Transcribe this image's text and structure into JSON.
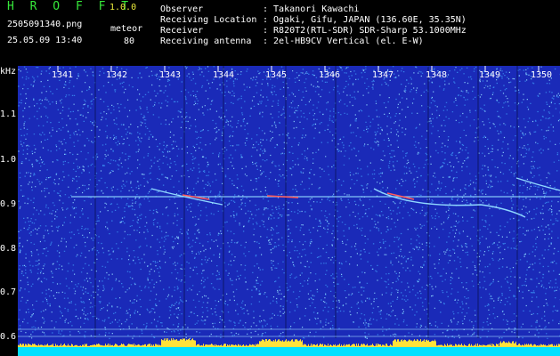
{
  "header": {
    "app_title": "H R O F F T",
    "version": "1.0.0",
    "filename": "2505091340.png",
    "datetime": "25.05.09 13:40",
    "count_label": "meteor",
    "count_value": "80",
    "fields": [
      {
        "label": "Observer",
        "value": ": Takanori Kawachi"
      },
      {
        "label": "Receiving Location",
        "value": ": Ogaki, Gifu, JAPAN (136.60E, 35.35N)"
      },
      {
        "label": "Receiver",
        "value": ": R820T2(RTL-SDR) SDR-Sharp 53.1000MHz"
      },
      {
        "label": "Receiving antenna",
        "value": ": 2el-HB9CV Vertical (el. E-W)"
      }
    ]
  },
  "spectrogram": {
    "y_unit": "kHz",
    "y_ticks": [
      "1.1",
      "1.0",
      "0.9",
      "0.8",
      "0.7",
      "0.6"
    ],
    "x_ticks": [
      "1341",
      "1342",
      "1343",
      "1344",
      "1345",
      "1346",
      "1347",
      "1348",
      "1349",
      "1350"
    ],
    "colors": {
      "background": "#1a2ab8",
      "noise_light": "#8fd8ff",
      "noise_mid": "#3a8cf0",
      "carrier": "#ffe23a",
      "baseline": "#00e0ff",
      "echo": "#ff5a5a"
    }
  }
}
